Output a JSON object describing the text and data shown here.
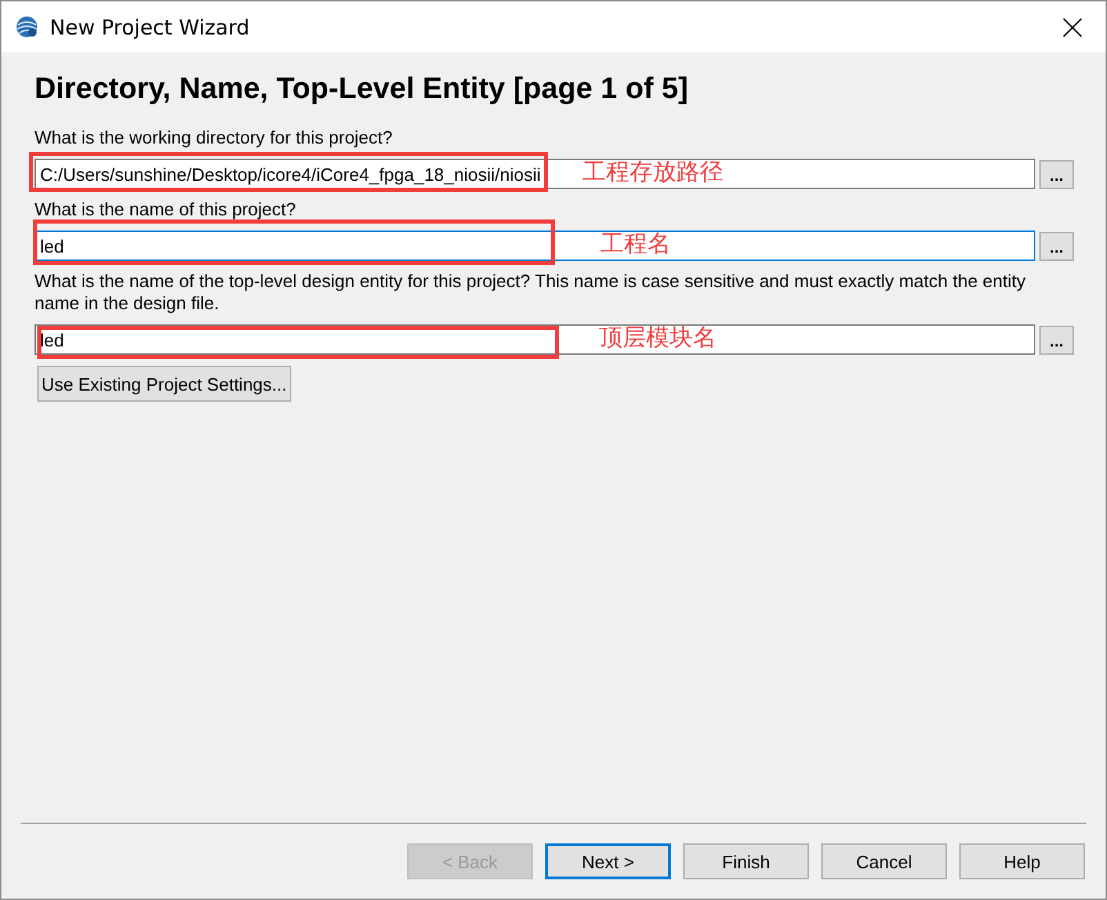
{
  "window": {
    "title": "New Project Wizard"
  },
  "heading": "Directory, Name, Top-Level Entity [page 1 of 5]",
  "fields": [
    {
      "label": "What is the working directory for this project?",
      "value": "C:/Users/sunshine/Desktop/icore4/iCore4_fpga_18_niosii/niosii",
      "focused": false,
      "browse": "...",
      "annotation": "工程存放路径"
    },
    {
      "label": "What is the name of this project?",
      "value": "led",
      "focused": true,
      "browse": "...",
      "annotation": "工程名"
    },
    {
      "label": "What is the name of the top-level design entity for this project? This name is case sensitive and must exactly match the entity name in the design file.",
      "value": "led",
      "focused": false,
      "browse": "...",
      "annotation": "顶层模块名"
    }
  ],
  "settings_button": "Use Existing Project Settings...",
  "buttons": [
    {
      "label": "< Back",
      "disabled": true,
      "default": false
    },
    {
      "label": "Next >",
      "disabled": false,
      "default": true
    },
    {
      "label": "Finish",
      "disabled": false,
      "default": false
    },
    {
      "label": "Cancel",
      "disabled": false,
      "default": false
    },
    {
      "label": "Help",
      "disabled": false,
      "default": false
    }
  ]
}
